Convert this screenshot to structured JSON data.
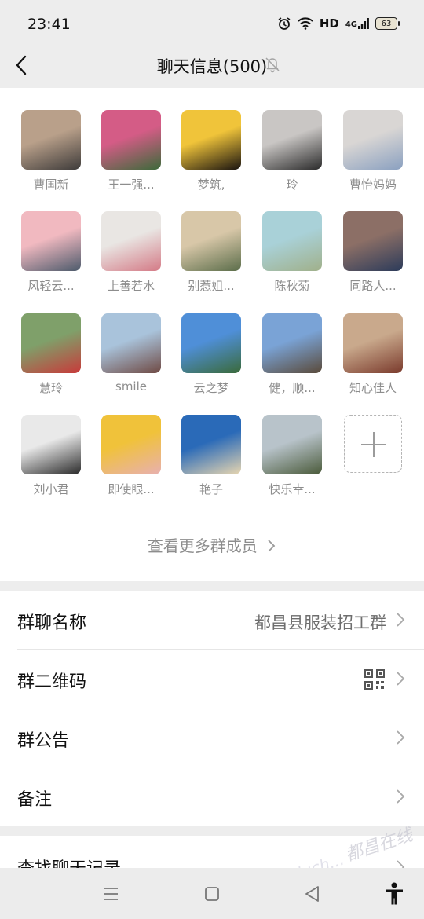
{
  "status": {
    "time": "23:41",
    "network": "HD",
    "signal": "4G",
    "battery": "63"
  },
  "header": {
    "title": "聊天信息(500)"
  },
  "members": [
    {
      "name": "曹国新",
      "colors": [
        "#b9a08a",
        "#3e3b3a"
      ]
    },
    {
      "name": "王一强...",
      "colors": [
        "#d45c86",
        "#3c6a3a"
      ]
    },
    {
      "name": "梦筑,",
      "colors": [
        "#f0c43a",
        "#1a1410"
      ]
    },
    {
      "name": "玲",
      "colors": [
        "#c9c6c4",
        "#2b2b2b"
      ]
    },
    {
      "name": "曹怡妈妈",
      "colors": [
        "#d9d6d4",
        "#8aa0c0"
      ]
    },
    {
      "name": "风轻云...",
      "colors": [
        "#f1b9c0",
        "#4c5a6b"
      ]
    },
    {
      "name": "上善若水",
      "colors": [
        "#e9e6e3",
        "#d47a86"
      ]
    },
    {
      "name": "别惹姐...",
      "colors": [
        "#d8c7a8",
        "#5b6d4a"
      ]
    },
    {
      "name": "陈秋菊",
      "colors": [
        "#a9d1d8",
        "#a0b08a"
      ]
    },
    {
      "name": "同路人...",
      "colors": [
        "#8c6f66",
        "#2c3b5a"
      ]
    },
    {
      "name": "慧玲",
      "colors": [
        "#7fa06a",
        "#c83a3a"
      ]
    },
    {
      "name": "smile",
      "colors": [
        "#a9c3db",
        "#6f4a44"
      ]
    },
    {
      "name": "云之梦",
      "colors": [
        "#4f8fd8",
        "#3a6a3a"
      ]
    },
    {
      "name": "健，顺...",
      "colors": [
        "#7aa3d6",
        "#5a4a3a"
      ]
    },
    {
      "name": "知心佳人",
      "colors": [
        "#c9a98c",
        "#7a3a2c"
      ]
    },
    {
      "name": "刘小君",
      "colors": [
        "#e9e9e9",
        "#2a2a2a"
      ]
    },
    {
      "name": "即使眼...",
      "colors": [
        "#f0c23a",
        "#e8b0b0"
      ]
    },
    {
      "name": "艳子",
      "colors": [
        "#2a6ab8",
        "#e8d6b0"
      ]
    },
    {
      "name": "快乐幸...",
      "colors": [
        "#b8c3ca",
        "#4a5a3a"
      ]
    }
  ],
  "more_members": "查看更多群成员",
  "settings": [
    {
      "label": "群聊名称",
      "value": "都昌县服装招工群"
    },
    {
      "label": "群二维码",
      "value": ""
    },
    {
      "label": "群公告",
      "value": ""
    },
    {
      "label": "备注",
      "value": ""
    }
  ],
  "search_history": "查找聊天记录",
  "watermark": {
    "line1": "都昌在线",
    "line2": "www.duch..."
  }
}
